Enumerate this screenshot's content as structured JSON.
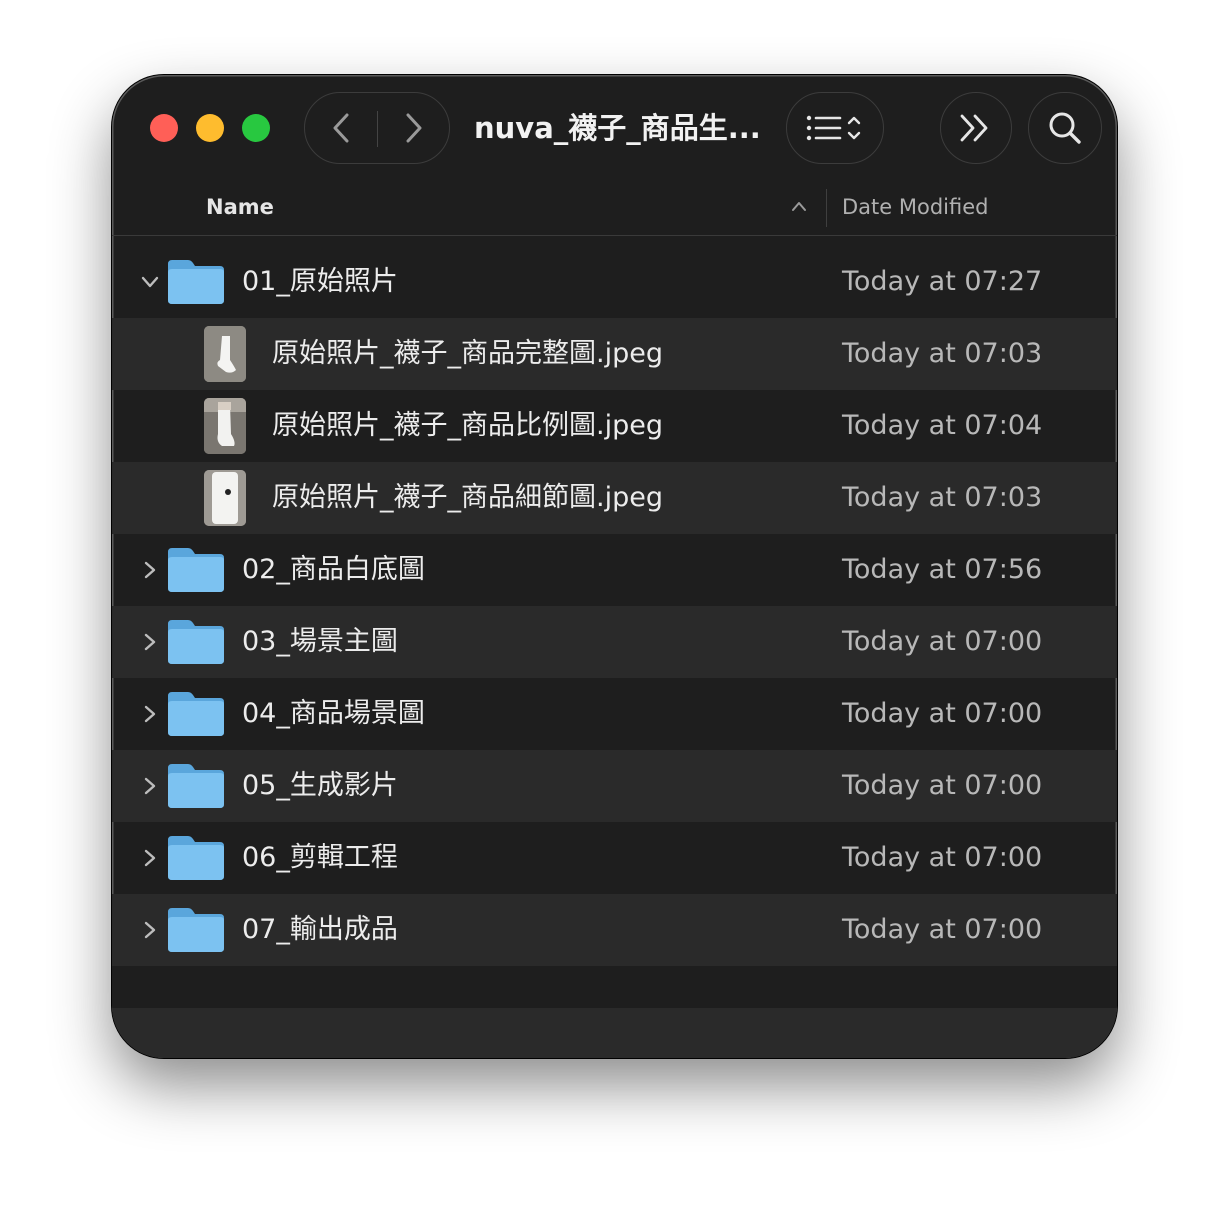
{
  "window": {
    "title": "nuva_襪子_商品生...",
    "colors": {
      "background": "#1e1e1e",
      "row_alt": "#2a2a2a",
      "close": "#ff5f57",
      "minimize": "#febc2e",
      "zoom": "#28c840",
      "folder": "#6fb8ec"
    }
  },
  "toolbar": {
    "back_icon": "chevron-left-icon",
    "forward_icon": "chevron-right-icon",
    "view_icon": "list-view-icon",
    "more_icon": "double-chevron-right-icon",
    "search_icon": "search-icon"
  },
  "columns": {
    "name": "Name",
    "date": "Date Modified"
  },
  "rows": [
    {
      "name": "01_原始照片",
      "date": "Today at 07:27",
      "kind": "folder",
      "expanded": true
    },
    {
      "name": "原始照片_襪子_商品完整圖.jpeg",
      "date": "Today at 07:03",
      "kind": "file"
    },
    {
      "name": "原始照片_襪子_商品比例圖.jpeg",
      "date": "Today at 07:04",
      "kind": "file"
    },
    {
      "name": "原始照片_襪子_商品細節圖.jpeg",
      "date": "Today at 07:03",
      "kind": "file"
    },
    {
      "name": "02_商品白底圖",
      "date": "Today at 07:56",
      "kind": "folder",
      "expanded": false
    },
    {
      "name": "03_場景主圖",
      "date": "Today at 07:00",
      "kind": "folder",
      "expanded": false
    },
    {
      "name": "04_商品場景圖",
      "date": "Today at 07:00",
      "kind": "folder",
      "expanded": false
    },
    {
      "name": "05_生成影片",
      "date": "Today at 07:00",
      "kind": "folder",
      "expanded": false
    },
    {
      "name": "06_剪輯工程",
      "date": "Today at 07:00",
      "kind": "folder",
      "expanded": false
    },
    {
      "name": "07_輸出成品",
      "date": "Today at 07:00",
      "kind": "folder",
      "expanded": false
    }
  ]
}
